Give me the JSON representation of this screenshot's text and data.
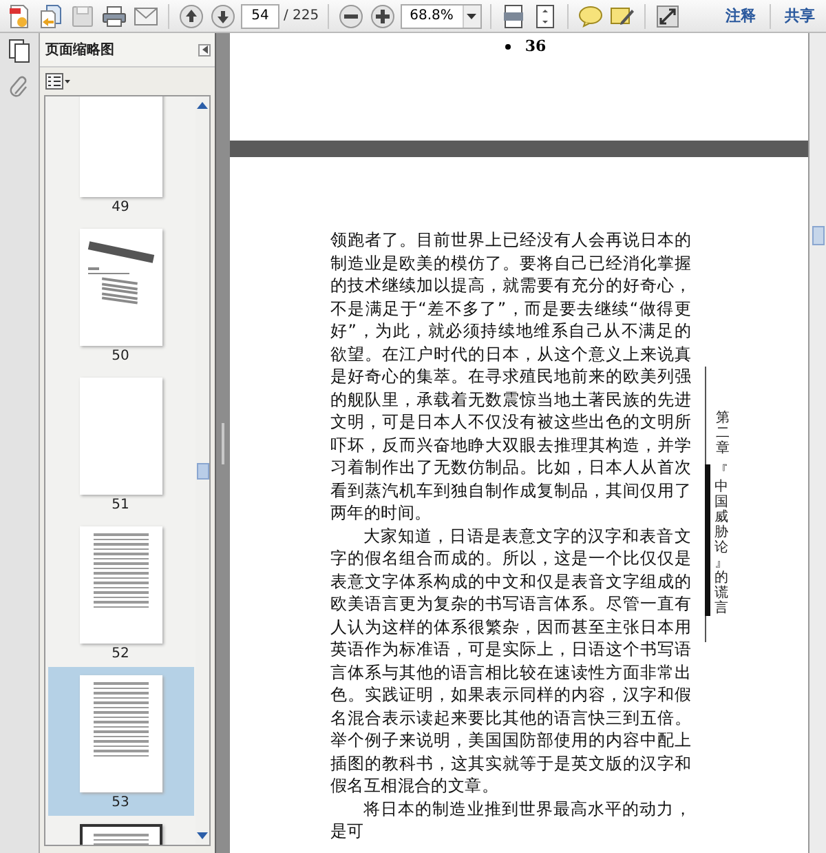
{
  "toolbar": {
    "page_field": "54",
    "page_count": "/ 225",
    "zoom_field": "68.8%",
    "links": [
      "注释",
      "共享"
    ]
  },
  "sidebar": {
    "title": "页面缩略图",
    "thumbnails": [
      {
        "label": "49",
        "kind": "blank",
        "selected": false,
        "current": false
      },
      {
        "label": "50",
        "kind": "chapter",
        "selected": false,
        "current": false
      },
      {
        "label": "51",
        "kind": "blank",
        "selected": false,
        "current": false
      },
      {
        "label": "52",
        "kind": "text",
        "selected": false,
        "current": false
      },
      {
        "label": "53",
        "kind": "text",
        "selected": true,
        "current": false
      },
      {
        "kind": "text",
        "selected": false,
        "current": true
      }
    ]
  },
  "document": {
    "page_number": "36",
    "paragraphs": [
      {
        "indent": false,
        "text": "领跑者了。目前世界上已经没有人会再说日本的制造业是欧美的模仿了。要将自己已经消化掌握的技术继续加以提高，就需要有充分的好奇心，不是满足于“差不多了”，而是要去继续“做得更好”，为此，就必须持续地维系自己从不满足的欲望。在江户时代的日本，从这个意义上来说真是好奇心的集萃。在寻求殖民地前来的欧美列强的舰队里，承载着无数震惊当地土著民族的先进文明，可是日本人不仅没有被这些出色的文明所吓坏，反而兴奋地睁大双眼去推理其构造，并学习着制作出了无数仿制品。比如，日本人从首次看到蒸汽机车到独自制作成复制品，其间仅用了两年的时间。"
      },
      {
        "indent": true,
        "text": "大家知道，日语是表意文字的汉字和表音文字的假名组合而成的。所以，这是一个比仅仅是表意文字体系构成的中文和仅是表音文字组成的欧美语言更为复杂的书写语言体系。尽管一直有人认为这样的体系很繁杂，因而甚至主张日本用英语作为标准语，可是实际上，日语这个书写语言体系与其他的语言相比较在速读性方面非常出色。实践证明，如果表示同样的内容，汉字和假名混合表示读起来要比其他的语言快三到五倍。举个例子来说明，美国国防部使用的内容中配上插图的教科书，这其实就等于是英文版的汉字和假名互相混合的文章。"
      },
      {
        "indent": true,
        "text": "将日本的制造业推到世界最高水平的动力，是可"
      }
    ],
    "side_heading": {
      "chapter": "第二章",
      "title": "『中国威胁论』的谎言"
    }
  }
}
